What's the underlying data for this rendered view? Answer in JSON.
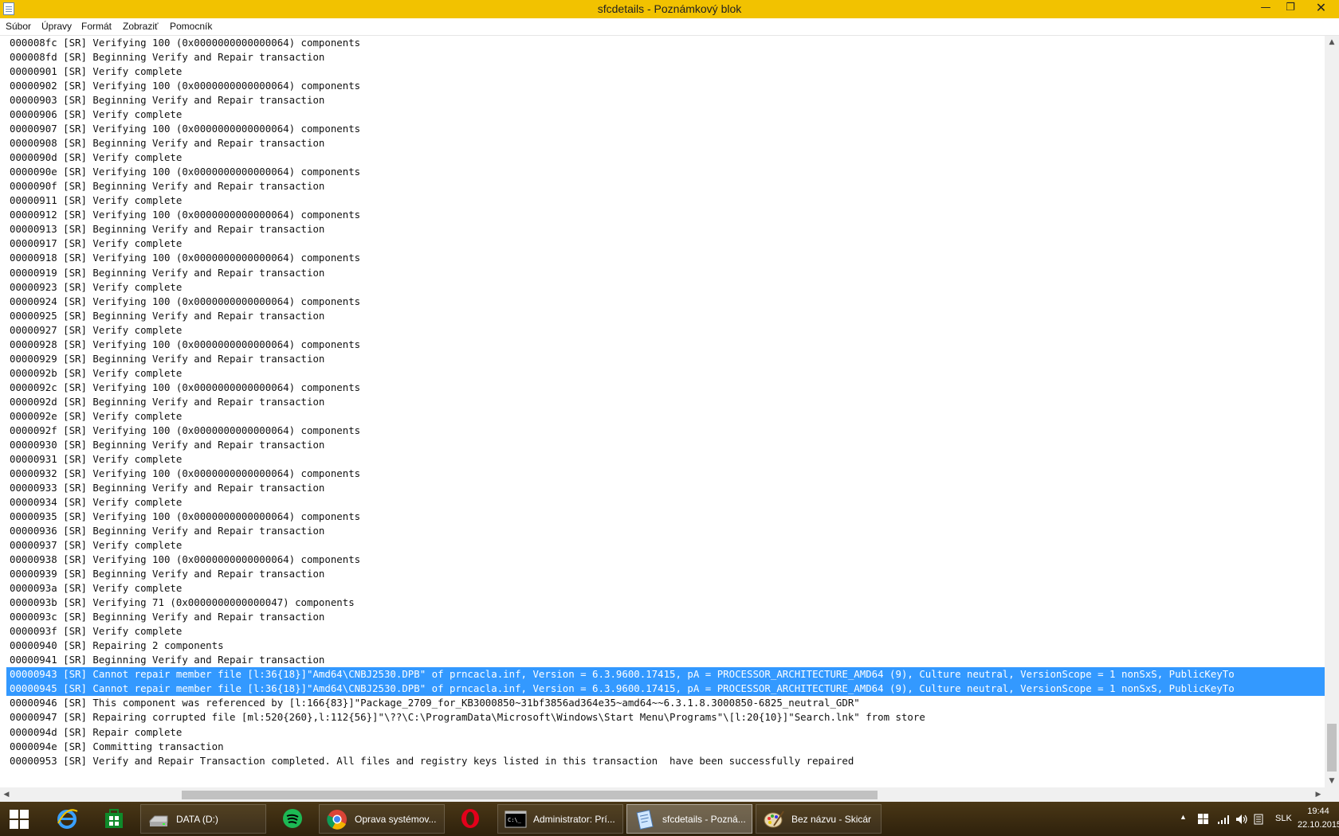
{
  "window": {
    "title": "sfcdetails - Poznámkový blok",
    "min_glyph": "—",
    "max_glyph": "❐",
    "close_glyph": "✕"
  },
  "menu": [
    "Súbor",
    "Úpravy",
    "Formát",
    "Zobraziť",
    "Pomocník"
  ],
  "lines": [
    "000008fc [SR] Verifying 100 (0x0000000000000064) components",
    "000008fd [SR] Beginning Verify and Repair transaction",
    "00000901 [SR] Verify complete",
    "00000902 [SR] Verifying 100 (0x0000000000000064) components",
    "00000903 [SR] Beginning Verify and Repair transaction",
    "00000906 [SR] Verify complete",
    "00000907 [SR] Verifying 100 (0x0000000000000064) components",
    "00000908 [SR] Beginning Verify and Repair transaction",
    "0000090d [SR] Verify complete",
    "0000090e [SR] Verifying 100 (0x0000000000000064) components",
    "0000090f [SR] Beginning Verify and Repair transaction",
    "00000911 [SR] Verify complete",
    "00000912 [SR] Verifying 100 (0x0000000000000064) components",
    "00000913 [SR] Beginning Verify and Repair transaction",
    "00000917 [SR] Verify complete",
    "00000918 [SR] Verifying 100 (0x0000000000000064) components",
    "00000919 [SR] Beginning Verify and Repair transaction",
    "00000923 [SR] Verify complete",
    "00000924 [SR] Verifying 100 (0x0000000000000064) components",
    "00000925 [SR] Beginning Verify and Repair transaction",
    "00000927 [SR] Verify complete",
    "00000928 [SR] Verifying 100 (0x0000000000000064) components",
    "00000929 [SR] Beginning Verify and Repair transaction",
    "0000092b [SR] Verify complete",
    "0000092c [SR] Verifying 100 (0x0000000000000064) components",
    "0000092d [SR] Beginning Verify and Repair transaction",
    "0000092e [SR] Verify complete",
    "0000092f [SR] Verifying 100 (0x0000000000000064) components",
    "00000930 [SR] Beginning Verify and Repair transaction",
    "00000931 [SR] Verify complete",
    "00000932 [SR] Verifying 100 (0x0000000000000064) components",
    "00000933 [SR] Beginning Verify and Repair transaction",
    "00000934 [SR] Verify complete",
    "00000935 [SR] Verifying 100 (0x0000000000000064) components",
    "00000936 [SR] Beginning Verify and Repair transaction",
    "00000937 [SR] Verify complete",
    "00000938 [SR] Verifying 100 (0x0000000000000064) components",
    "00000939 [SR] Beginning Verify and Repair transaction",
    "0000093a [SR] Verify complete",
    "0000093b [SR] Verifying 71 (0x0000000000000047) components",
    "0000093c [SR] Beginning Verify and Repair transaction",
    "0000093f [SR] Verify complete",
    "00000940 [SR] Repairing 2 components",
    "00000941 [SR] Beginning Verify and Repair transaction",
    "00000943 [SR] Cannot repair member file [l:36{18}]\"Amd64\\CNBJ2530.DPB\" of prncacla.inf, Version = 6.3.9600.17415, pA = PROCESSOR_ARCHITECTURE_AMD64 (9), Culture neutral, VersionScope = 1 nonSxS, PublicKeyTo",
    "00000945 [SR] Cannot repair member file [l:36{18}]\"Amd64\\CNBJ2530.DPB\" of prncacla.inf, Version = 6.3.9600.17415, pA = PROCESSOR_ARCHITECTURE_AMD64 (9), Culture neutral, VersionScope = 1 nonSxS, PublicKeyTo",
    "00000946 [SR] This component was referenced by [l:166{83}]\"Package_2709_for_KB3000850~31bf3856ad364e35~amd64~~6.3.1.8.3000850-6825_neutral_GDR\"",
    "00000947 [SR] Repairing corrupted file [ml:520{260},l:112{56}]\"\\??\\C:\\ProgramData\\Microsoft\\Windows\\Start Menu\\Programs\"\\[l:20{10}]\"Search.lnk\" from store",
    "0000094d [SR] Repair complete",
    "0000094e [SR] Committing transaction",
    "00000953 [SR] Verify and Repair Transaction completed. All files and registry keys listed in this transaction  have been successfully repaired"
  ],
  "selected_line_indices": [
    44,
    45
  ],
  "taskbar": {
    "items": [
      {
        "label": "",
        "icon": "internet-explorer-icon"
      },
      {
        "label": "",
        "icon": "store-icon"
      },
      {
        "label": "DATA (D:)",
        "icon": "drive-icon"
      },
      {
        "label": "",
        "icon": "spotify-icon"
      },
      {
        "label": "Oprava systémov...",
        "icon": "chrome-icon"
      },
      {
        "label": "",
        "icon": "opera-icon"
      },
      {
        "label": "Administrator: Prí...",
        "icon": "cmd-icon"
      },
      {
        "label": "sfcdetails - Pozná...",
        "icon": "notepad-icon"
      },
      {
        "label": "Bez názvu - Skicár",
        "icon": "paint-icon"
      }
    ]
  },
  "tray": {
    "language": "SLK",
    "time": "19:44",
    "date": "22.10.2015"
  },
  "colors": {
    "titlebar": "#f2c200",
    "selection": "#3399ff",
    "taskbar": "#3b2a10"
  }
}
